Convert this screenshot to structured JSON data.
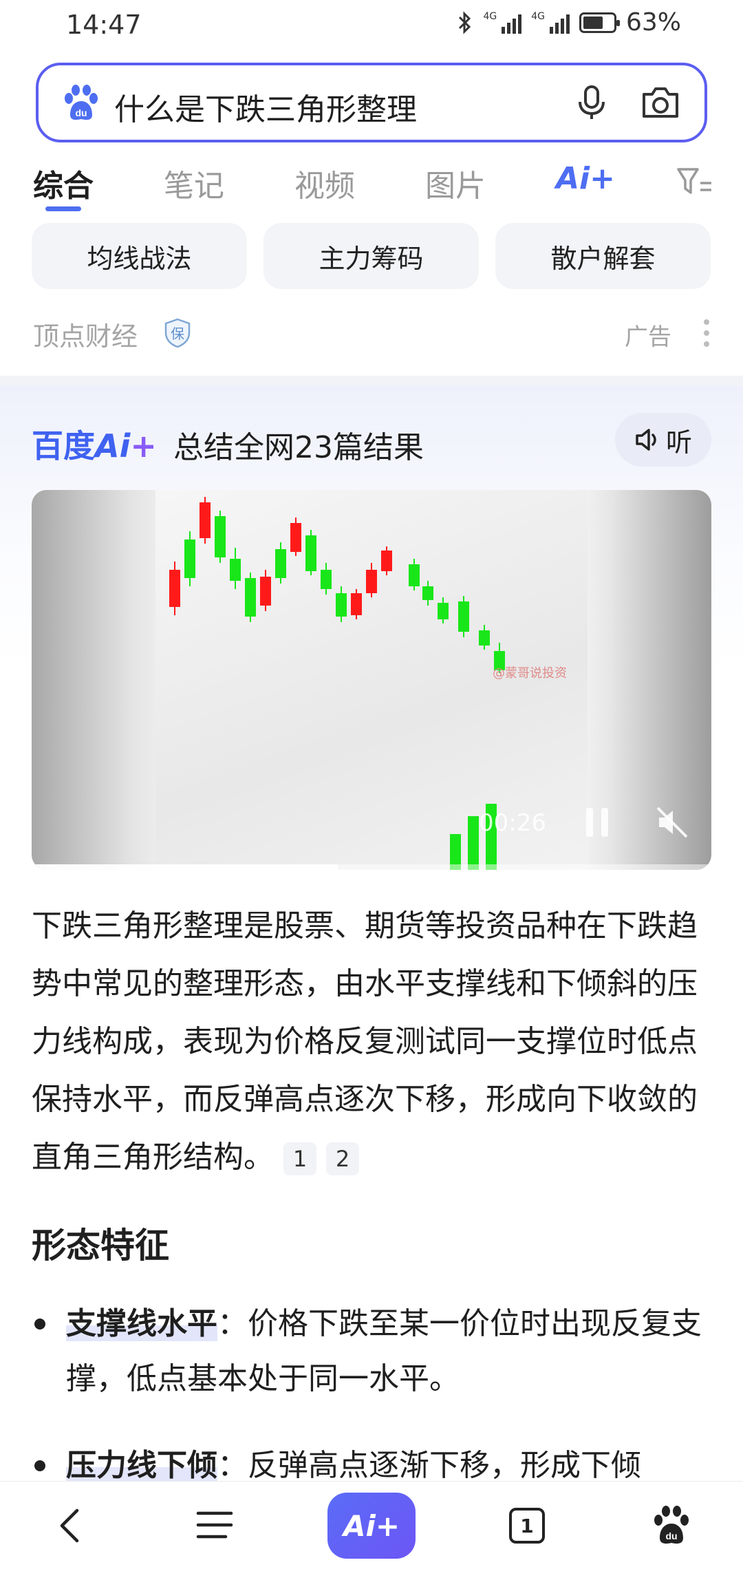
{
  "status_bar": {
    "time": "14:47",
    "network_1": "4G",
    "network_2": "4G",
    "battery_percent": "63%",
    "battery_level": 0.63
  },
  "search": {
    "query": "什么是下跌三角形整理"
  },
  "tabs": [
    {
      "label": "综合",
      "active": true
    },
    {
      "label": "笔记",
      "active": false
    },
    {
      "label": "视频",
      "active": false
    },
    {
      "label": "图片",
      "active": false
    }
  ],
  "ai_tab": {
    "label": "Ai+"
  },
  "chips": [
    "均线战法",
    "主力筹码",
    "散户解套"
  ],
  "ad": {
    "source": "顶点财经",
    "badge": "保",
    "label": "广告"
  },
  "ai_panel": {
    "brand_prefix": "百度",
    "brand_ai": "Ai",
    "brand_star": "+",
    "summary": "总结全网23篇结果",
    "listen_label": "听"
  },
  "video": {
    "watermark": "@蒙哥说投资",
    "time": "00:26",
    "progress": 0.45
  },
  "answer": {
    "paragraph": "下跌三角形整理是股票、期货等投资品种在下跌趋势中常见的整理形态，由水平支撑线和下倾斜的压力线构成，表现为价格反复测试同一支撑位时低点保持水平，而反弹高点逐次下移，形成向下收敛的直角三角形结构。",
    "citations": [
      "1",
      "2"
    ],
    "section_title": "形态特征",
    "bullets": [
      {
        "term": "支撑线水平",
        "sep": "：",
        "text": "价格下跌至某一价位时出现反复支撑，低点基本处于同一水平。"
      },
      {
        "term": "压力线下倾",
        "sep": "：",
        "text": "反弹高点逐渐下移，形成下倾"
      }
    ]
  },
  "bottom_nav": {
    "ai_label": "Ai+",
    "tab_count": "1"
  },
  "colors": {
    "accent": "#4e6ef2",
    "search_border": "#5b5ef0",
    "candle_up": "#ff1a1a",
    "candle_down": "#19e619"
  }
}
